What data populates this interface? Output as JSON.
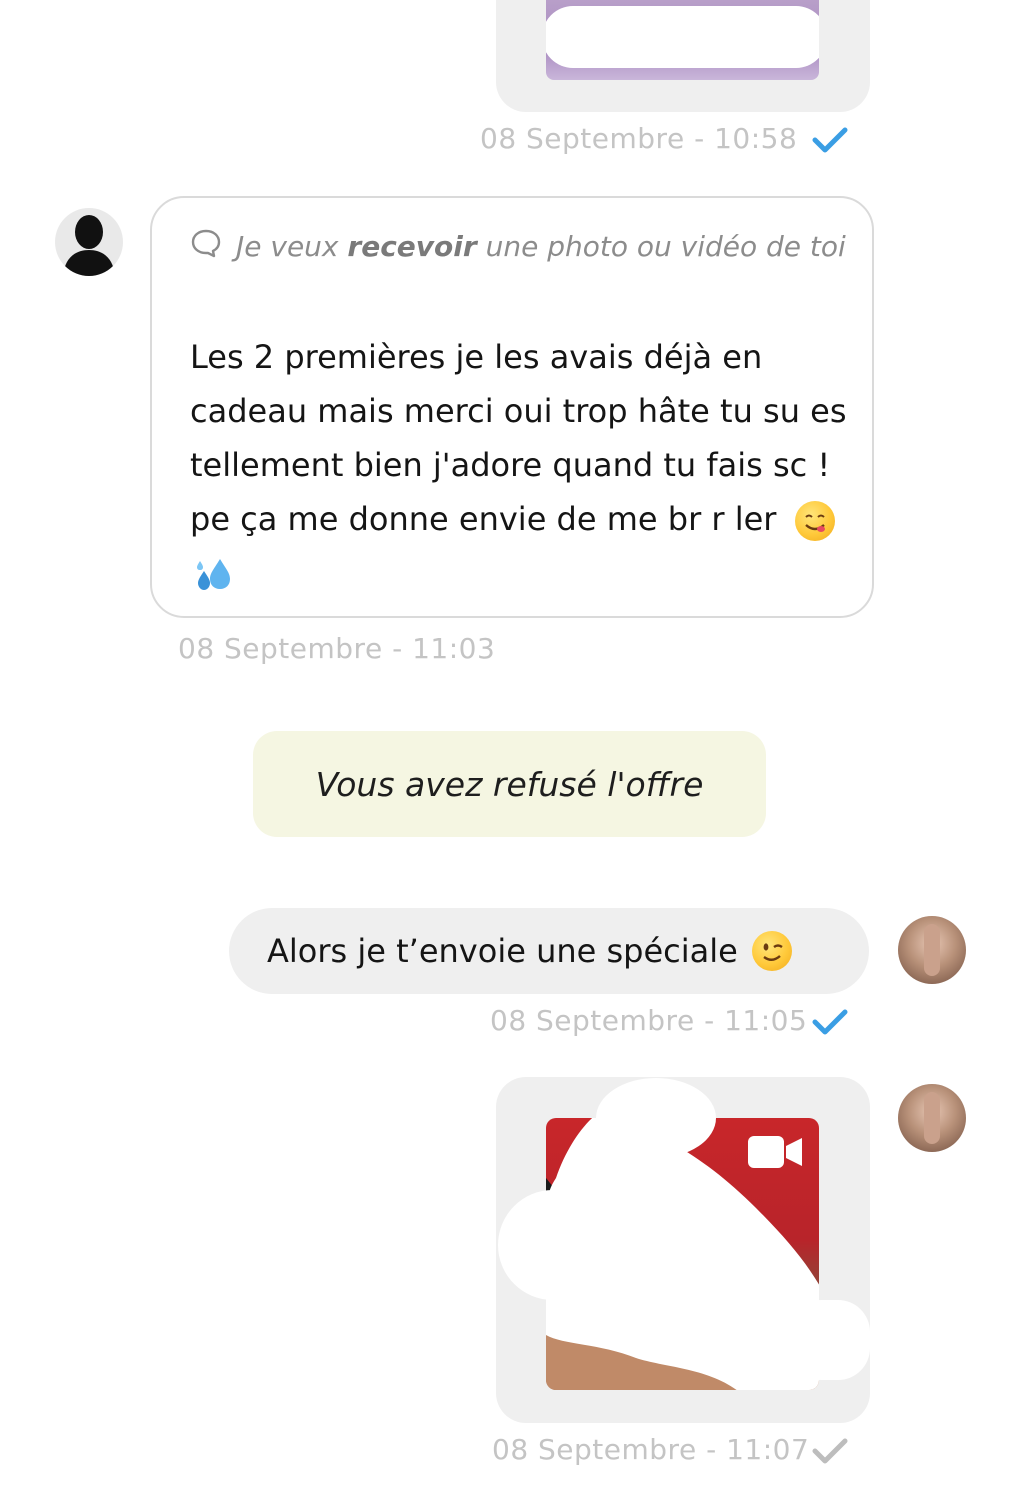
{
  "messages": {
    "photo_sent": {
      "timestamp": "08 Septembre - 10:58",
      "status_icon": "check-blue"
    },
    "received": {
      "offer_prefix": "Je veux ",
      "offer_bold": "recevoir",
      "offer_suffix": " une photo ou vidéo de toi",
      "text": "Les 2 premières je les avais déjà en cadeau mais merci oui trop hâte tu su  es tellement bien j'adore quand tu fais sc ! pe ça me donne envie de me br  r ler",
      "emoji_1": "yum-emoji",
      "emoji_2": "sweat-droplets-emoji",
      "timestamp": "08 Septembre - 11:03"
    },
    "system": {
      "text": "Vous avez refusé l'offre"
    },
    "sent_text": {
      "text": "Alors je t’envoie une spéciale",
      "emoji": "wink-emoji",
      "timestamp": "08 Septembre - 11:05",
      "status_icon": "check-blue"
    },
    "video_sent": {
      "icon": "video-camera-icon",
      "timestamp": "08 Septembre - 11:07",
      "status_icon": "check-grey"
    }
  },
  "colors": {
    "check_blue": "#3a9ee4",
    "check_grey": "#bdbdbd",
    "system_banner_bg": "#f5f6e2",
    "bubble_bg": "#efefef",
    "video_thumb_red": "#c8262a"
  }
}
